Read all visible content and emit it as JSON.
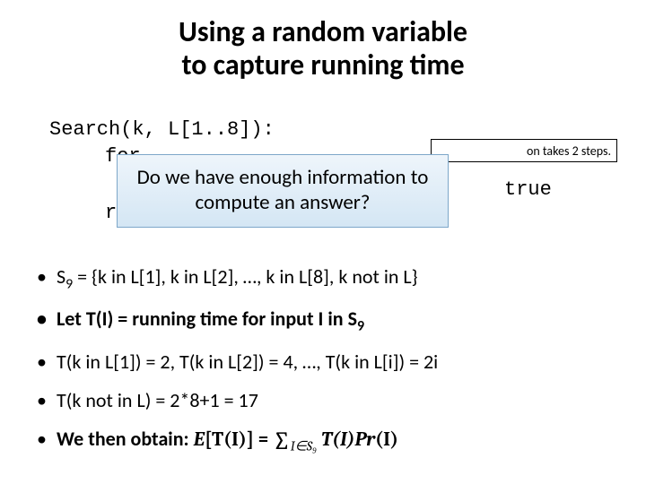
{
  "title_line1": "Using a random variable",
  "title_line2": "to capture running time",
  "code": {
    "line1": "Search(k, L[1..8]):",
    "line2": "for",
    "line3": "ret"
  },
  "callout_assume": "on takes 2 steps.",
  "callout_question": "Do we have enough information to compute an answer?",
  "true_label": "true",
  "bullets": {
    "b1_prefix": "S",
    "b1_sub": "9",
    "b1_rest": " = {k in L[1], k in L[2], …, k in L[8], k not in L}",
    "b2_prefix": "Let T(I) = running time for input I in S",
    "b2_sub": "9",
    "b3": "T(k in L[1]) = 2, T(k in L[2]) = 4, …, T(k in L[i]) = 2i",
    "b4": "T(k not in L) = 2*8+1 = 17",
    "b5_prefix": "We then obtain: ",
    "b5_lhs_E": "E",
    "b5_lhs_inside": "[T(I)]",
    "b5_eq": " = ",
    "b5_sum": "∑",
    "b5_sum_sub": "I∈S₉",
    "b5_TI": " T(I)",
    "b5_Pr": "Pr",
    "b5_PrArg": "(I)"
  }
}
